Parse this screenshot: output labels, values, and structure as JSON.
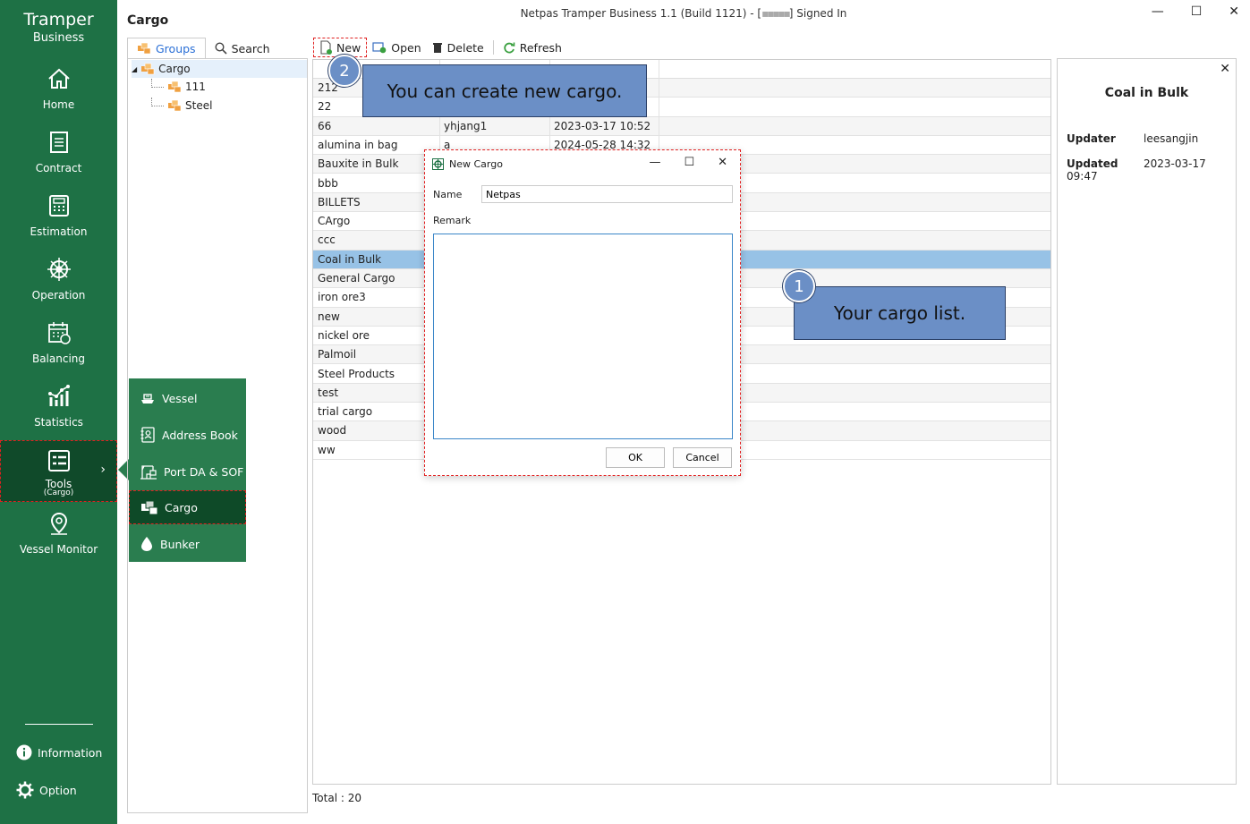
{
  "window": {
    "title": "Netpas Tramper Business 1.1 (Build 1121) - [",
    "title_masked": "▪▪▪▪▪",
    "title_suffix": "] Signed In",
    "minimize": "—",
    "maximize": "☐",
    "close": "✕"
  },
  "brand": {
    "line1": "Tramper",
    "line2": "Business"
  },
  "sidebar": {
    "items": [
      {
        "label": "Home",
        "icon": "home-icon"
      },
      {
        "label": "Contract",
        "icon": "document-icon"
      },
      {
        "label": "Estimation",
        "icon": "calculator-icon"
      },
      {
        "label": "Operation",
        "icon": "ship-wheel-icon"
      },
      {
        "label": "Balancing",
        "icon": "calendar-icon"
      },
      {
        "label": "Statistics",
        "icon": "chart-icon"
      },
      {
        "label": "Tools",
        "sub": "(Cargo)",
        "icon": "tools-icon",
        "active": true
      },
      {
        "label": "Vessel Monitor",
        "icon": "location-pin-icon"
      }
    ],
    "information": "Information",
    "option": "Option",
    "chevron": "›"
  },
  "flyout": {
    "items": [
      {
        "label": "Vessel",
        "icon": "ship-icon"
      },
      {
        "label": "Address Book",
        "icon": "contact-book-icon"
      },
      {
        "label": "Port DA & SOF",
        "icon": "port-crane-icon"
      },
      {
        "label": "Cargo",
        "icon": "cargo-boxes-icon",
        "active": true
      },
      {
        "label": "Bunker",
        "icon": "fuel-drop-icon"
      }
    ]
  },
  "page": {
    "title": "Cargo"
  },
  "left_panel": {
    "tabs": [
      {
        "label": "Groups",
        "selected": true
      },
      {
        "label": "Search"
      }
    ],
    "tree": {
      "root": "Cargo",
      "children": [
        "111",
        "Steel"
      ],
      "expander": "◢"
    }
  },
  "toolbar": {
    "new": "New",
    "open": "Open",
    "delete": "Delete",
    "refresh": "Refresh"
  },
  "grid": {
    "rows": [
      {
        "name": "212",
        "user": "",
        "date": ""
      },
      {
        "name": "22",
        "user": "",
        "date": ""
      },
      {
        "name": "66",
        "user": "yhjang1",
        "date": "2023-03-17 10:52"
      },
      {
        "name": "alumina in bag",
        "user": "a",
        "date": "2024-05-28 14:32"
      },
      {
        "name": "Bauxite in Bulk",
        "user": "",
        "date": ""
      },
      {
        "name": "bbb",
        "user": "",
        "date": ""
      },
      {
        "name": "BILLETS",
        "user": "",
        "date": ""
      },
      {
        "name": "CArgo",
        "user": "",
        "date": ""
      },
      {
        "name": "ccc",
        "user": "",
        "date": ""
      },
      {
        "name": "Coal in Bulk",
        "user": "",
        "date": "",
        "selected": true
      },
      {
        "name": "General Cargo",
        "user": "",
        "date": ""
      },
      {
        "name": "iron ore3",
        "user": "",
        "date": ""
      },
      {
        "name": "new",
        "user": "",
        "date": ""
      },
      {
        "name": "nickel ore",
        "user": "",
        "date": ""
      },
      {
        "name": "Palmoil",
        "user": "",
        "date": ""
      },
      {
        "name": "Steel Products",
        "user": "",
        "date": ""
      },
      {
        "name": "test",
        "user": "",
        "date": ""
      },
      {
        "name": "trial cargo",
        "user": "",
        "date": ""
      },
      {
        "name": "wood",
        "user": "",
        "date": ""
      },
      {
        "name": "ww",
        "user": "",
        "date": ""
      }
    ],
    "total": "Total : 20"
  },
  "detail": {
    "title": "Coal in Bulk",
    "close": "✕",
    "fields": [
      {
        "key": "Updater",
        "value": "leesangjin"
      },
      {
        "key": "Updated",
        "value": "2023-03-17 09:47"
      }
    ]
  },
  "dialog": {
    "title": "New Cargo",
    "name_label": "Name",
    "name_value": "Netpas",
    "remark_label": "Remark",
    "remark_value": "",
    "ok": "OK",
    "cancel": "Cancel",
    "minimize": "—",
    "maximize": "☐",
    "close": "✕"
  },
  "callouts": [
    {
      "number": "1",
      "text": "Your cargo list."
    },
    {
      "number": "2",
      "text": "You can create new cargo."
    }
  ],
  "colors": {
    "sidebar": "#1e7145",
    "selected_row": "#97c2e6",
    "callout": "#6b8fc6",
    "highlight": "#e02020"
  }
}
